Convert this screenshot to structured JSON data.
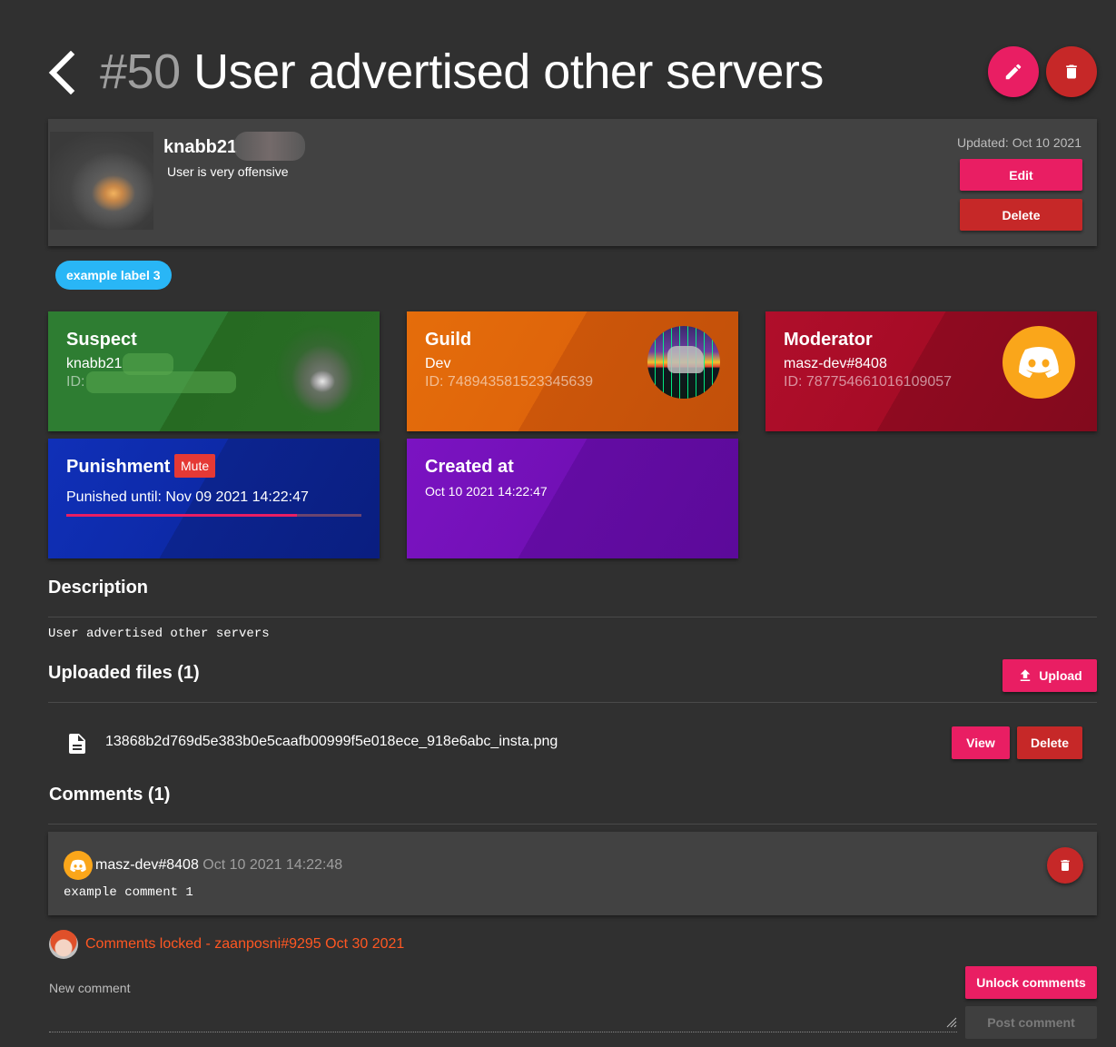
{
  "header": {
    "case_number": "#50",
    "title": "User advertised other servers"
  },
  "case": {
    "username": "knabb21",
    "reason": "User is very offensive",
    "updated": "Updated: Oct 10 2021",
    "edit_label": "Edit",
    "delete_label": "Delete",
    "labels": [
      "example label 3"
    ]
  },
  "cards": {
    "suspect": {
      "title": "Suspect",
      "name": "knabb21",
      "id_label": "ID:"
    },
    "guild": {
      "title": "Guild",
      "name": "Dev",
      "id": "ID: 748943581523345639"
    },
    "moderator": {
      "title": "Moderator",
      "name": "masz-dev#8408",
      "id": "ID: 787754661016109057"
    },
    "punishment": {
      "title": "Punishment",
      "badge": "Mute",
      "until": "Punished until: Nov 09 2021 14:22:47",
      "progress": 0.78
    },
    "created": {
      "title": "Created at",
      "date": "Oct 10 2021 14:22:47"
    }
  },
  "description": {
    "heading": "Description",
    "text": "User advertised other servers"
  },
  "files": {
    "heading": "Uploaded files (1)",
    "upload_label": "Upload",
    "items": [
      {
        "name": "13868b2d769d5e383b0e5caafb00999f5e018ece_918e6abc_insta.png",
        "view_label": "View",
        "delete_label": "Delete"
      }
    ]
  },
  "comments": {
    "heading": "Comments (1)",
    "items": [
      {
        "user": "masz-dev#8408",
        "date": "Oct 10 2021 14:22:48",
        "text": "example comment 1"
      }
    ],
    "locked_text": "Comments locked - zaanposni#9295 Oct 30 2021",
    "new_comment_label": "New comment",
    "unlock_label": "Unlock comments",
    "post_label": "Post comment"
  },
  "colors": {
    "accent": "#e91e63",
    "danger": "#c62828",
    "background": "#303030",
    "card": "#424242",
    "suspect": "#2e7d32",
    "guild": "#e56d0b",
    "moderator": "#b00e2b",
    "punishment": "#1030b8",
    "created": "#7b13c2",
    "locked": "#ff5722"
  },
  "icons": [
    "back-arrow-icon",
    "pencil-icon",
    "trash-icon",
    "discord-icon",
    "file-icon",
    "upload-icon"
  ]
}
